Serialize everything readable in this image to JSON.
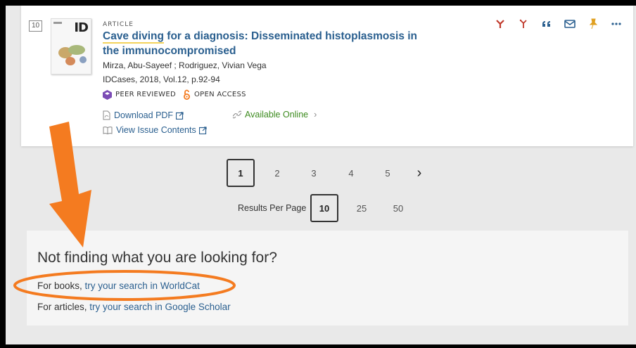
{
  "result": {
    "number": "10",
    "type": "ARTICLE",
    "title_highlight": "Cave diving",
    "title_rest": " for a diagnosis: Disseminated histoplasmosis in the immunocompromised",
    "authors": "Mirza, Abu-Sayeef ; Rodriguez, Vivian Vega",
    "source": "IDCases, 2018, Vol.12, p.92-94",
    "thumb_logo": "ID",
    "badges": {
      "peer_reviewed": "PEER REVIEWED",
      "open_access": "OPEN ACCESS"
    },
    "links": {
      "download_pdf": "Download PDF",
      "available_online": "Available Online",
      "view_issue": "View Issue Contents"
    },
    "actions": [
      {
        "name": "cite-icon-red",
        "color": "#c0392b"
      },
      {
        "name": "export-icon",
        "color": "#c0392b"
      },
      {
        "name": "quote-icon",
        "color": "#2a5f8f"
      },
      {
        "name": "email-icon",
        "color": "#2a5f8f"
      },
      {
        "name": "pin-icon",
        "color": "#e0a020"
      },
      {
        "name": "more-icon",
        "color": "#2a5f8f"
      }
    ]
  },
  "pagination": {
    "pages": [
      "1",
      "2",
      "3",
      "4",
      "5"
    ],
    "current": "1",
    "next": "›"
  },
  "results_per_page": {
    "label": "Results Per Page",
    "options": [
      "10",
      "25",
      "50"
    ],
    "selected": "10"
  },
  "not_finding": {
    "heading": "Not finding what you are looking for?",
    "books_prefix": "For books, ",
    "books_link": "try your search in WorldCat",
    "articles_prefix": "For articles, ",
    "articles_link": "try your search in Google Scholar"
  },
  "annotation_colors": {
    "arrow": "#f47b20",
    "ellipse": "#f47b20"
  }
}
